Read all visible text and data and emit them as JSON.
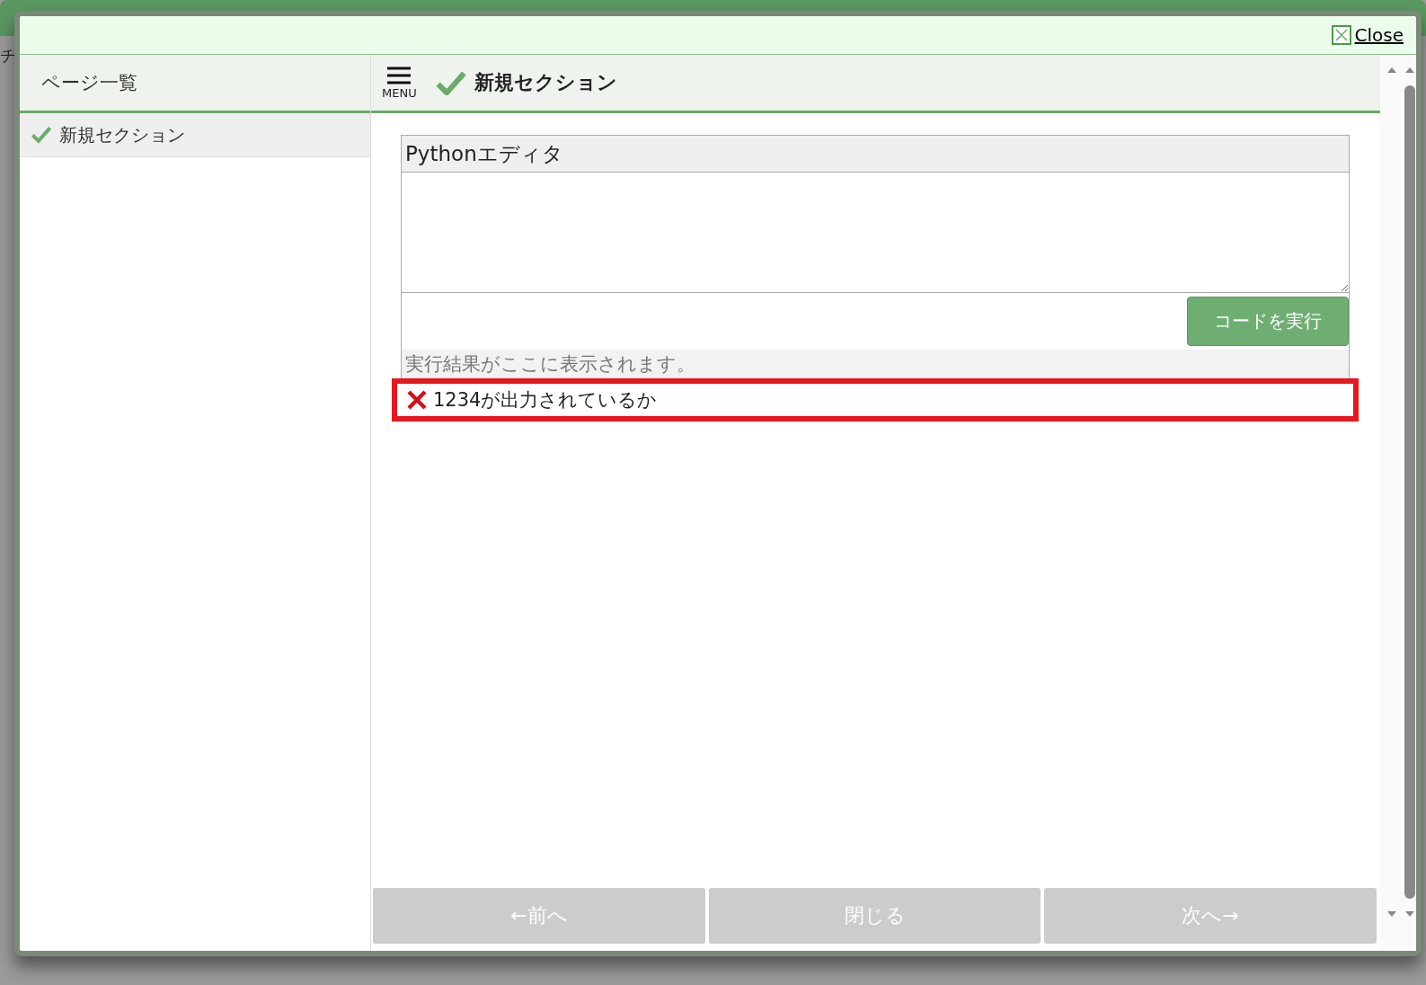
{
  "background": {
    "text": "チ"
  },
  "dialog": {
    "close": "Close"
  },
  "sidebar": {
    "title": "ページ一覧",
    "items": [
      {
        "label": "新規セクション",
        "done": true,
        "selected": true
      }
    ]
  },
  "header": {
    "menu": "MENU",
    "title": "新規セクション",
    "done": true
  },
  "editor": {
    "title": "Pythonエディタ",
    "run_button": "コードを実行",
    "output_placeholder": "実行結果がここに表示されます。"
  },
  "tests": [
    {
      "label": "1234が出力されているか",
      "passed": false,
      "highlighted": true
    }
  ],
  "nav": [
    {
      "label": "←前へ",
      "disabled": true
    },
    {
      "label": "閉じる",
      "disabled": true
    },
    {
      "label": "次へ→",
      "disabled": true
    }
  ]
}
